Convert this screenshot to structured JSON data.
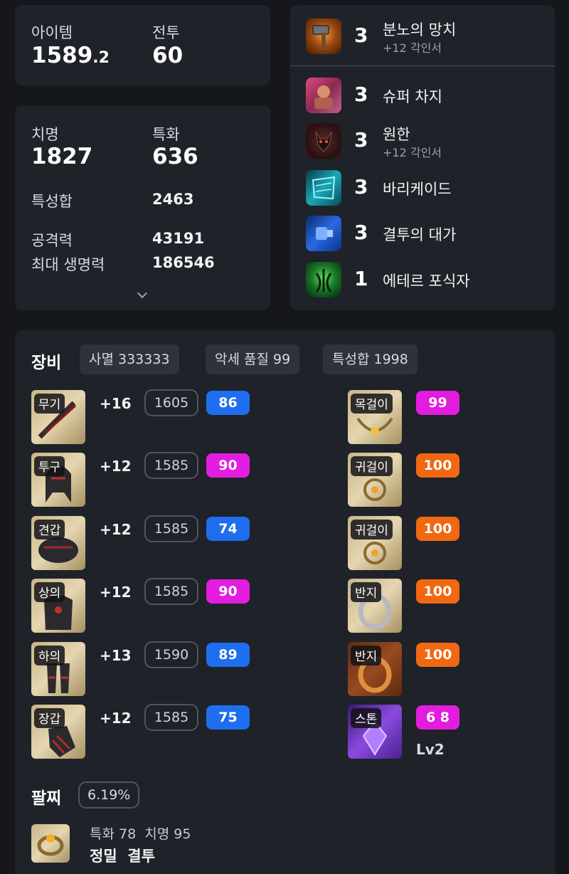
{
  "summary": {
    "item_label": "아이템",
    "item_value_main": "1589",
    "item_value_frac": ".2",
    "combat_label": "전투",
    "combat_value": "60"
  },
  "stats": {
    "crit_label": "치명",
    "crit_value": "1827",
    "spec_label": "특화",
    "spec_value": "636",
    "total_label": "특성합",
    "total_value": "2463",
    "attack_label": "공격력",
    "attack_value": "43191",
    "hp_label": "최대 생명력",
    "hp_value": "186546"
  },
  "engravings": [
    {
      "level": "3",
      "name": "분노의 망치",
      "sub": "+12 각인서",
      "icon": "hammer-icon"
    },
    {
      "level": "3",
      "name": "슈퍼 차지",
      "sub": "",
      "icon": "super-charge-icon"
    },
    {
      "level": "3",
      "name": "원한",
      "sub": "+12 각인서",
      "icon": "grudge-icon"
    },
    {
      "level": "3",
      "name": "바리케이드",
      "sub": "",
      "icon": "barricade-icon"
    },
    {
      "level": "3",
      "name": "결투의 대가",
      "sub": "",
      "icon": "master-brawler-icon"
    },
    {
      "level": "1",
      "name": "에테르 포식자",
      "sub": "",
      "icon": "ether-predator-icon"
    }
  ],
  "equipment": {
    "title": "장비",
    "chips": [
      "사멸 333333",
      "악세 품질 99",
      "특성합 1998"
    ],
    "gear": [
      {
        "slot": "무기",
        "refine": "+16",
        "ilvl": "1605",
        "quality": "86",
        "qcolor": "blue"
      },
      {
        "slot": "투구",
        "refine": "+12",
        "ilvl": "1585",
        "quality": "90",
        "qcolor": "pink"
      },
      {
        "slot": "견갑",
        "refine": "+12",
        "ilvl": "1585",
        "quality": "74",
        "qcolor": "blue"
      },
      {
        "slot": "상의",
        "refine": "+12",
        "ilvl": "1585",
        "quality": "90",
        "qcolor": "pink"
      },
      {
        "slot": "하의",
        "refine": "+13",
        "ilvl": "1590",
        "quality": "89",
        "qcolor": "blue"
      },
      {
        "slot": "장갑",
        "refine": "+12",
        "ilvl": "1585",
        "quality": "75",
        "qcolor": "blue"
      }
    ],
    "accessories": [
      {
        "slot": "목걸이",
        "quality": "99",
        "qcolor": "pink"
      },
      {
        "slot": "귀걸이",
        "quality": "100",
        "qcolor": "orange"
      },
      {
        "slot": "귀걸이",
        "quality": "100",
        "qcolor": "orange"
      },
      {
        "slot": "반지",
        "quality": "100",
        "qcolor": "orange"
      },
      {
        "slot": "반지",
        "quality": "100",
        "qcolor": "orange"
      },
      {
        "slot": "스톤",
        "quality": "6 8",
        "qcolor": "pink",
        "extra": "Lv2"
      }
    ]
  },
  "bracelet": {
    "title": "팔찌",
    "percent": "6.19%",
    "stats": "특화 78  치명 95",
    "effects": "정밀  결투"
  },
  "colors": {
    "background": "#15171c",
    "card": "#1f2229",
    "quality_blue": "#1f6ef0",
    "quality_pink": "#e21de0",
    "quality_orange": "#f06812"
  }
}
